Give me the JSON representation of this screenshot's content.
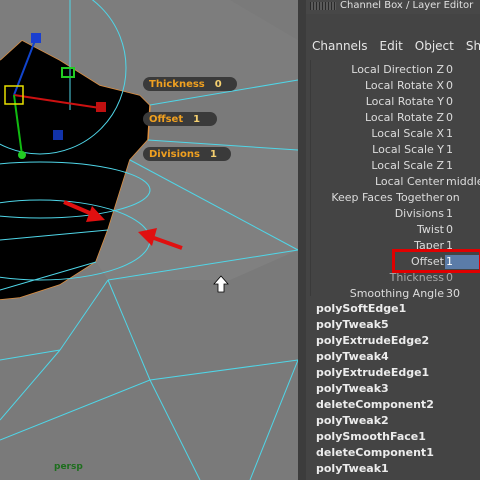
{
  "panel": {
    "title": "Channel Box / Layer Editor",
    "menu": [
      "Channels",
      "Edit",
      "Object",
      "Show"
    ]
  },
  "viewport": {
    "camera_label": "persp",
    "hud": {
      "thickness_label": "Thickness",
      "thickness_value": "0",
      "offset_label": "Offset",
      "offset_value": "1",
      "divisions_label": "Divisions",
      "divisions_value": "1"
    }
  },
  "channels": [
    {
      "label": "Local Direction Z",
      "value": "0"
    },
    {
      "label": "Local Rotate X",
      "value": "0"
    },
    {
      "label": "Local Rotate Y",
      "value": "0"
    },
    {
      "label": "Local Rotate Z",
      "value": "0"
    },
    {
      "label": "Local Scale X",
      "value": "1"
    },
    {
      "label": "Local Scale Y",
      "value": "1"
    },
    {
      "label": "Local Scale Z",
      "value": "1"
    },
    {
      "label": "Local Center",
      "value": "middle"
    },
    {
      "label": "Keep Faces Together",
      "value": "on"
    },
    {
      "label": "Divisions",
      "value": "1"
    },
    {
      "label": "Twist",
      "value": "0"
    },
    {
      "label": "Taper",
      "value": "1"
    },
    {
      "label": "Offset",
      "value": "1"
    },
    {
      "label": "Thickness",
      "value": "0"
    }
  ],
  "smoothing": {
    "label": "Smoothing Angle",
    "value": "30"
  },
  "history": [
    "polySoftEdge1",
    "polyTweak5",
    "polyExtrudeEdge2",
    "polyTweak4",
    "polyExtrudeEdge1",
    "polyTweak3",
    "deleteComponent2",
    "polyTweak2",
    "polySmoothFace1",
    "deleteComponent1",
    "polyTweak1"
  ],
  "colors": {
    "viewport_bg": "#7a7a7a",
    "wire": "#4fd6e8",
    "highlight": "#e00000",
    "hud_text": "#f0a020",
    "selected_value": "#5b7ca8"
  }
}
